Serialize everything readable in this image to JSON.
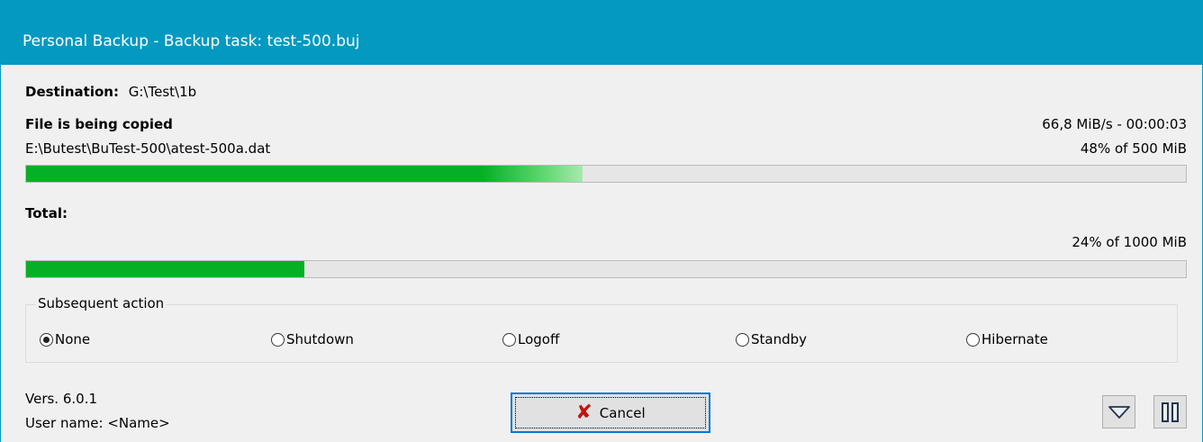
{
  "window": {
    "title": "Personal Backup - Backup task: test-500.buj",
    "accent": "#0399c0"
  },
  "destination": {
    "label": "Destination:",
    "value": "G:\\Test\\1b"
  },
  "file": {
    "status": "File is being copied",
    "speed_time": "66,8 MiB/s - 00:00:03",
    "path": "E:\\Butest\\BuTest-500\\atest-500a.dat",
    "progress_text": "48% of 500 MiB",
    "progress": 0.48
  },
  "total": {
    "label": "Total:",
    "progress_text": "24% of 1000 MiB",
    "progress": 0.24
  },
  "subsequent_action": {
    "label": "Subsequent action",
    "options": [
      {
        "label": "None",
        "selected": true
      },
      {
        "label": "Shutdown",
        "selected": false
      },
      {
        "label": "Logoff",
        "selected": false
      },
      {
        "label": "Standby",
        "selected": false
      },
      {
        "label": "Hibernate",
        "selected": false
      }
    ]
  },
  "footer": {
    "version": "Vers. 6.0.1",
    "user": "User name: <Name>",
    "cancel_label": "Cancel",
    "cancel_icon": "red-x-icon",
    "expand_icon": "triangle-down-icon",
    "pause_icon": "pause-icon"
  },
  "colors": {
    "progress_green": "#06b025",
    "cancel_icon": "#c0150f"
  }
}
